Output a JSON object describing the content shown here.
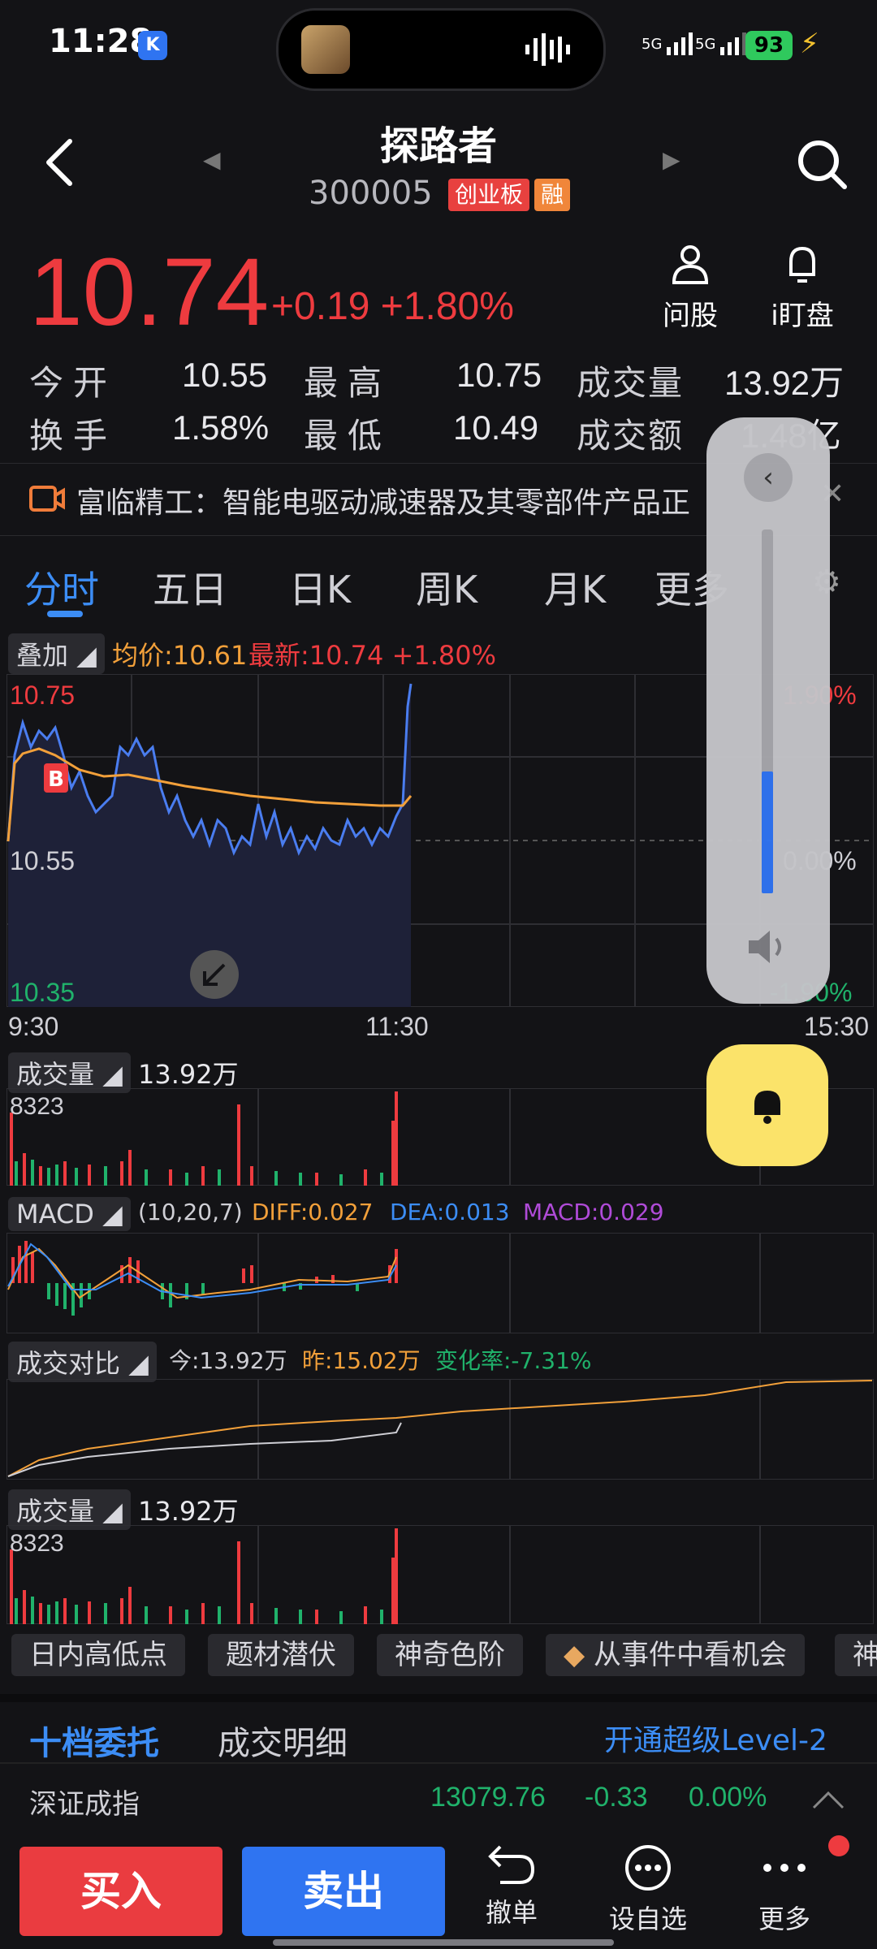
{
  "status_bar": {
    "time": "11:28",
    "k_badge": "K",
    "network1": "5G",
    "network2": "5G",
    "battery": "93"
  },
  "header": {
    "title": "探路者",
    "code": "300005",
    "tag_board": "创业板",
    "tag_margin": "融",
    "icons": [
      "back-icon",
      "search-icon"
    ]
  },
  "quote": {
    "price": "10.74",
    "change": "+0.19",
    "change_pct": "+1.80%",
    "actions": [
      {
        "label": "问股"
      },
      {
        "label": "i盯盘"
      }
    ],
    "stats": [
      {
        "label": "今开",
        "value": "10.55"
      },
      {
        "label": "最高",
        "value": "10.75"
      },
      {
        "label": "成交量",
        "value": "13.92万"
      },
      {
        "label": "换手",
        "value": "1.58%"
      },
      {
        "label": "最低",
        "value": "10.49"
      },
      {
        "label": "成交额",
        "value": "1.48亿"
      }
    ]
  },
  "news": {
    "text": "富临精工：智能电驱动减速器及其零部件产品正"
  },
  "tabs": [
    "分时",
    "五日",
    "日K",
    "周K",
    "月K",
    "更多"
  ],
  "intraday": {
    "overlay_label": "叠加",
    "avg_price": "均价:10.61",
    "latest": "最新:10.74 +1.80%",
    "y_top": "10.75",
    "y_mid": "10.55",
    "y_bottom": "10.35",
    "pct_top": "1.90%",
    "pct_mid": "0.00%",
    "pct_bottom": "-1.90%",
    "x_labels": [
      "9:30",
      "11:30",
      "15:30"
    ],
    "buy_marker": "B"
  },
  "volume_panel": {
    "label": "成交量",
    "value": "13.92万",
    "peak": "8323"
  },
  "macd_panel": {
    "label": "MACD",
    "params": "(10,20,7)",
    "diff": "DIFF:0.027",
    "dea": "DEA:0.013",
    "macd": "MACD:0.029"
  },
  "compare_panel": {
    "label": "成交对比",
    "today": "今:13.92万",
    "yesterday": "昨:15.02万",
    "change": "变化率:-7.31%"
  },
  "volume_panel2": {
    "label": "成交量",
    "value": "13.92万",
    "peak": "8323"
  },
  "feature_chips": [
    "日内高低点",
    "题材潜伏",
    "神奇色阶",
    "从事件中看机会",
    "神"
  ],
  "orderbook": {
    "tab_active": "十档委托",
    "tab2": "成交明细",
    "upgrade": "开通超级Level-2"
  },
  "index_row": {
    "name": "深证成指",
    "value": "13079.76",
    "change": "-0.33",
    "pct": "0.00%"
  },
  "bottom_bar": {
    "buy": "买入",
    "sell": "卖出",
    "items": [
      {
        "label": "撤单"
      },
      {
        "label": "设自选"
      },
      {
        "label": "更多"
      }
    ]
  },
  "colors": {
    "up": "#ee3b3f",
    "down": "#20b26b",
    "accent": "#3c8df5",
    "avg_line": "#f2a03a",
    "price_line": "#4a7df0"
  }
}
